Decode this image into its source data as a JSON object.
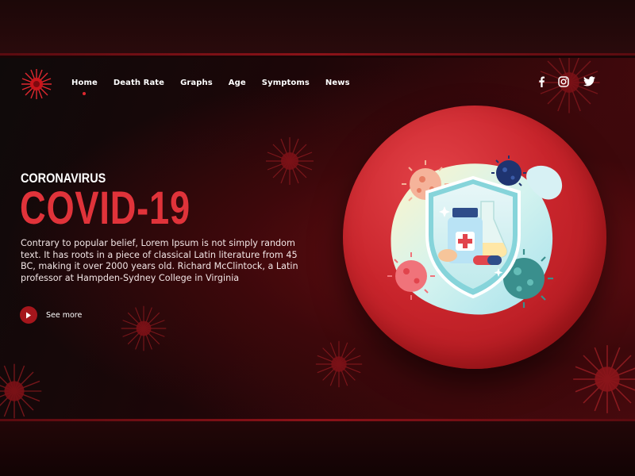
{
  "brand": {
    "logo_icon": "virus-logo-icon"
  },
  "nav": {
    "items": [
      {
        "label": "Home",
        "active": true
      },
      {
        "label": "Death Rate",
        "active": false
      },
      {
        "label": "Graphs",
        "active": false
      },
      {
        "label": "Age",
        "active": false
      },
      {
        "label": "Symptoms",
        "active": false
      },
      {
        "label": "News",
        "active": false
      }
    ]
  },
  "social": [
    "facebook-icon",
    "instagram-icon",
    "twitter-icon"
  ],
  "hero": {
    "eyebrow": "CORONAVIRUS",
    "title": "COVID-19",
    "description": "Contrary to popular belief, Lorem Ipsum is not simply random text. It has roots in a piece of classical Latin literature from 45 BC, making it over 2000 years old. Richard McClintock, a Latin professor at Hampden-Sydney College in Virginia",
    "cta_label": "See more"
  },
  "illustration": {
    "icon": "medical-shield-illustration"
  },
  "colors": {
    "accent": "#e0333a",
    "background": "#1a0506",
    "circle": "#c9252c"
  }
}
